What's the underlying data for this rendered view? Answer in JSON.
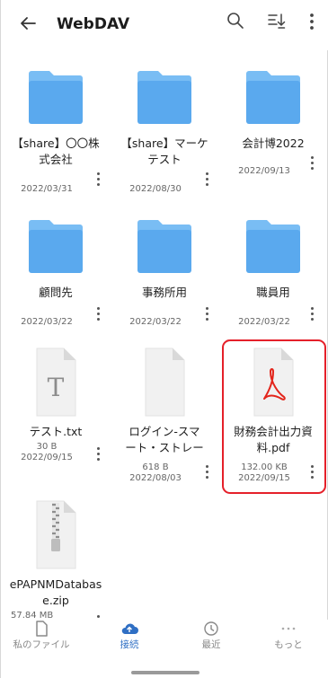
{
  "appbar": {
    "title": "WebDAV",
    "icons": [
      "back-arrow-icon",
      "search-icon",
      "sort-icon",
      "more-vertical-icon"
    ]
  },
  "items": [
    {
      "type": "folder",
      "name": "【share】〇〇株\n式会社",
      "date": "2022/03/31"
    },
    {
      "type": "folder",
      "name": "【share】マーケ\nテスト",
      "date": "2022/08/30"
    },
    {
      "type": "folder",
      "name": "会計博2022",
      "date": "2022/09/13"
    },
    {
      "type": "folder",
      "name": "顧問先",
      "date": "2022/03/22"
    },
    {
      "type": "folder",
      "name": "事務所用",
      "date": "2022/03/22"
    },
    {
      "type": "folder",
      "name": "職員用",
      "date": "2022/03/22"
    },
    {
      "type": "txt",
      "name": "テスト.txt",
      "size": "30 B",
      "date": "2022/09/15"
    },
    {
      "type": "file",
      "name": "ログイン-スマ\nート・ストレー",
      "size": "618 B",
      "date": "2022/08/03"
    },
    {
      "type": "pdf",
      "name": "財務会計出力資\n料.pdf",
      "size": "132.00 KB",
      "date": "2022/09/15",
      "highlighted": true
    },
    {
      "type": "zip",
      "name": "ePAPNMDatabas\ne.zip",
      "size": "57.84 MB"
    }
  ],
  "bottom_nav": [
    {
      "label": "私のファイル",
      "icon": "file-icon",
      "active": false
    },
    {
      "label": "接続",
      "icon": "cloud-icon",
      "active": true
    },
    {
      "label": "最近",
      "icon": "clock-icon",
      "active": false
    },
    {
      "label": "もっと",
      "icon": "more-horizontal-icon",
      "active": false
    }
  ],
  "colors": {
    "folder": "#5aa9ee",
    "folder_tab": "#79bdf4",
    "accent": "#2f6fc4",
    "highlight_border": "#e5202a",
    "pdf_red": "#e3251b"
  }
}
